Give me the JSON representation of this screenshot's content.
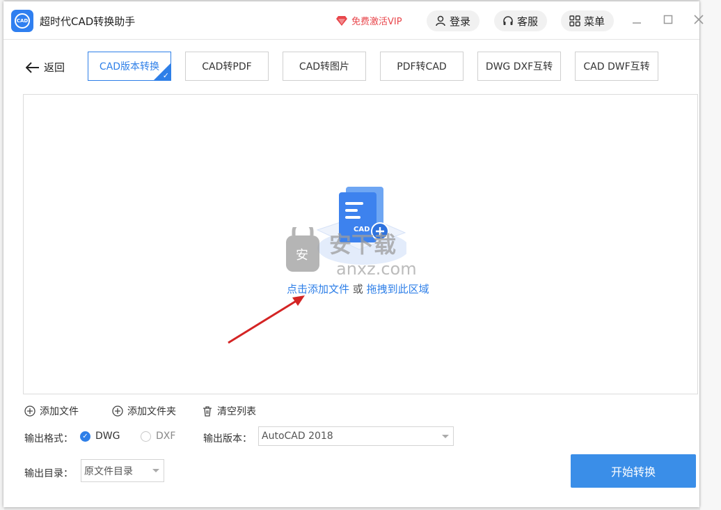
{
  "app": {
    "title": "超时代CAD转换助手",
    "logo_text": "CAD"
  },
  "header": {
    "vip_label": "免费激活VIP",
    "login_label": "登录",
    "service_label": "客服",
    "menu_label": "菜单"
  },
  "nav": {
    "back_label": "返回",
    "tabs": [
      {
        "label": "CAD版本转换",
        "active": true
      },
      {
        "label": "CAD转PDF"
      },
      {
        "label": "CAD转图片"
      },
      {
        "label": "PDF转CAD"
      },
      {
        "label": "DWG DXF互转"
      },
      {
        "label": "CAD DWF互转"
      }
    ]
  },
  "drop_area": {
    "icon_text": "CAD",
    "click_text": "点击添加文件",
    "or_text": " 或 ",
    "drag_text": "拖拽到此区域"
  },
  "watermark": {
    "text": "安下载",
    "domain": "anxz.com",
    "badge": "安"
  },
  "actions": {
    "add_file": "添加文件",
    "add_folder": "添加文件夹",
    "clear_list": "清空列表"
  },
  "output": {
    "format_label": "输出格式：",
    "format_options": [
      "DWG",
      "DXF"
    ],
    "selected_format": "DWG",
    "version_label": "输出版本：",
    "version_value": "AutoCAD 2018",
    "dir_label": "输出目录：",
    "dir_value": "原文件目录"
  },
  "start_button": "开始转换",
  "colors": {
    "accent": "#2e7fe8",
    "vip": "#e8464b",
    "button": "#3a8ee8"
  }
}
